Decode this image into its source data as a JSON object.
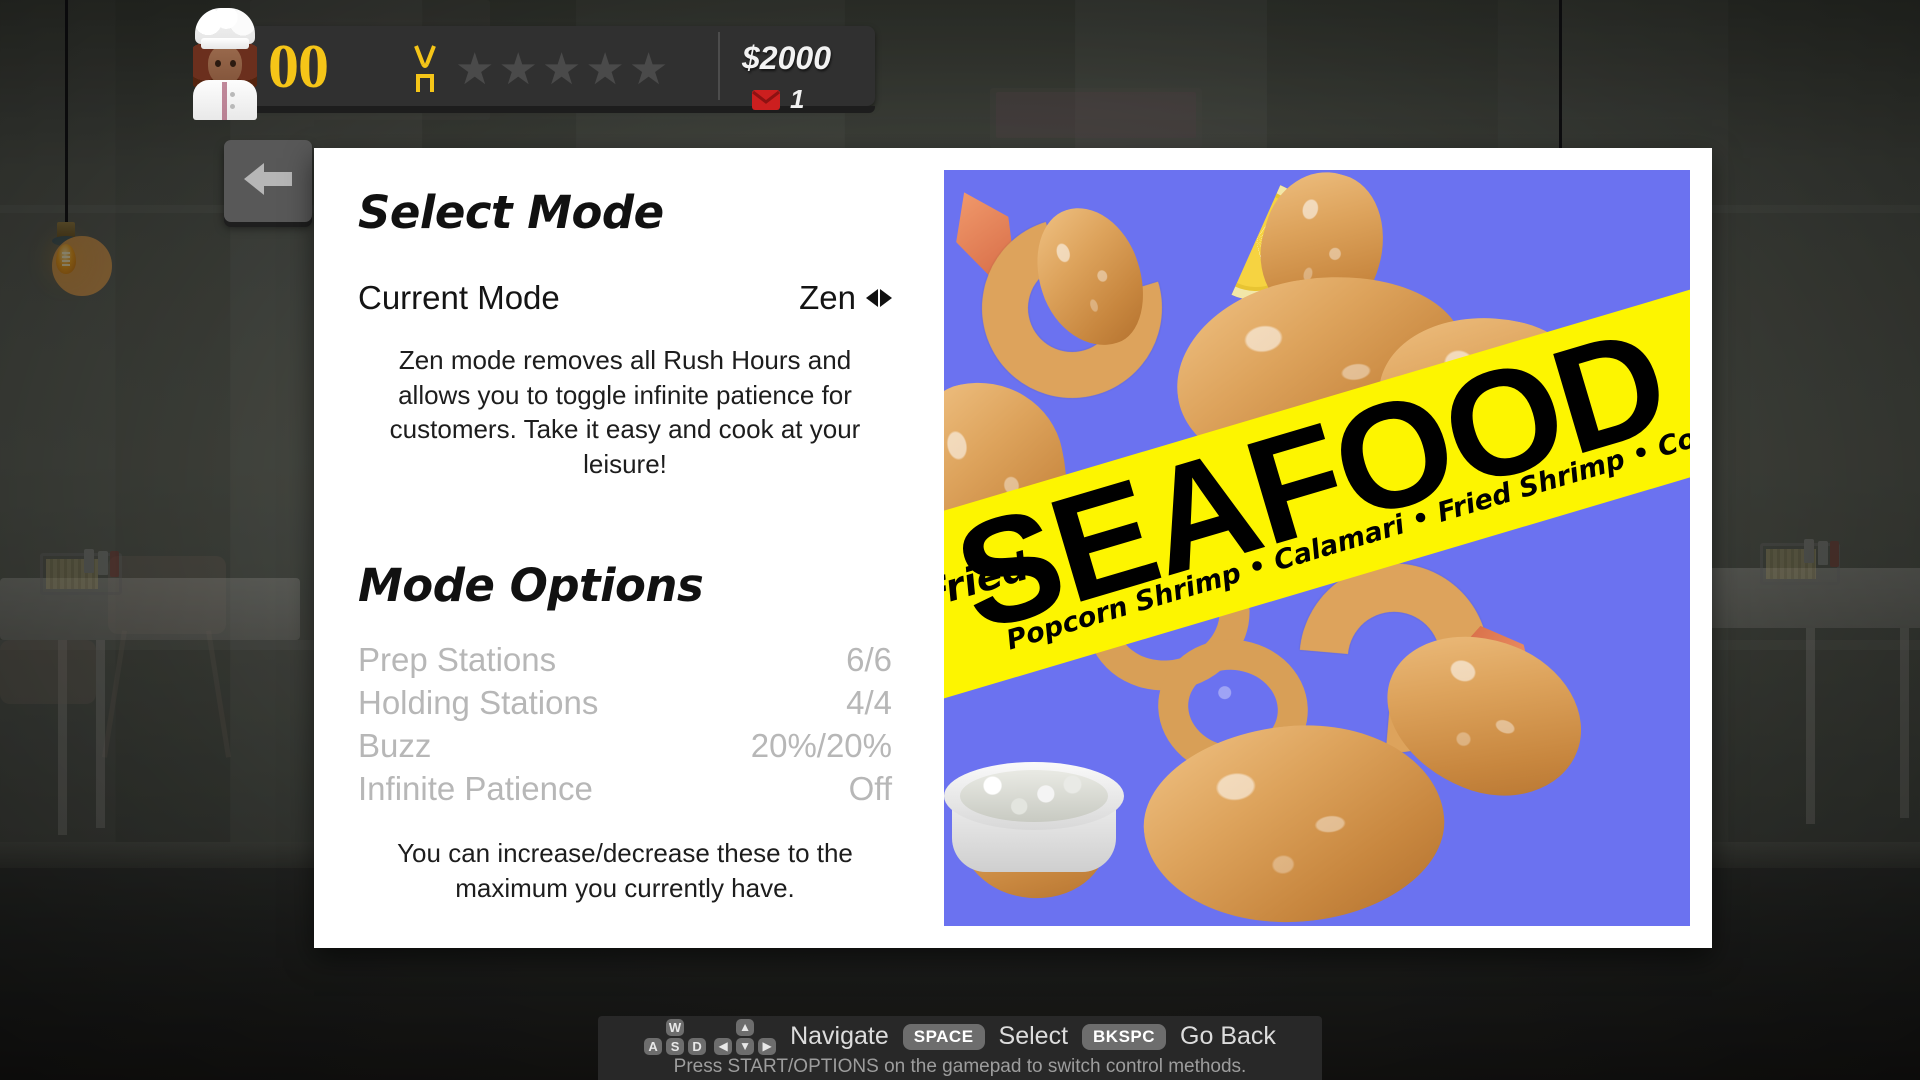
{
  "hud": {
    "level": "00",
    "utensil_icon": "fork-icon",
    "star_icon": "star-icon",
    "star_count": 5,
    "stars_filled": 0,
    "money": "$2000",
    "mail_icon": "envelope-icon",
    "mail_count": "1",
    "avatar": "chef-avatar",
    "back_icon": "back-arrow-icon",
    "accent_color": "#f5c518",
    "mail_color": "#cc1f1f"
  },
  "panel": {
    "select_mode_title": "Select Mode",
    "current_mode_label": "Current Mode",
    "current_mode_value": "Zen",
    "mode_arrows_icon": "left-right-arrows-icon",
    "mode_description": "Zen mode removes all Rush Hours and allows you to toggle infinite patience for customers. Take it easy and cook at your leisure!",
    "mode_options_title": "Mode Options",
    "options": [
      {
        "label": "Prep Stations",
        "value": "6/6"
      },
      {
        "label": "Holding Stations",
        "value": "4/4"
      },
      {
        "label": "Buzz",
        "value": "20%/20%"
      },
      {
        "label": "Infinite Patience",
        "value": "Off"
      }
    ],
    "options_note": "You can increase/decrease these to the maximum you currently have."
  },
  "poster": {
    "kicker": "Fried",
    "title": "SEAFOOD",
    "items": "Popcorn Shrimp • Calamari • Fried Shrimp • Cod • Fried Fish • Clam Strips",
    "band_color": "#fdf500",
    "background_color": "#6b72f0"
  },
  "controls": {
    "wasd": {
      "w": "W",
      "a": "A",
      "s": "S",
      "d": "D"
    },
    "arrows": {
      "up": "▲",
      "left": "◀",
      "down": "▼",
      "right": "▶"
    },
    "navigate_label": "Navigate",
    "select_key": "SPACE",
    "select_label": "Select",
    "back_key": "BKSPC",
    "back_label": "Go Back",
    "hint": "Press START/OPTIONS on the gamepad to switch control methods."
  }
}
